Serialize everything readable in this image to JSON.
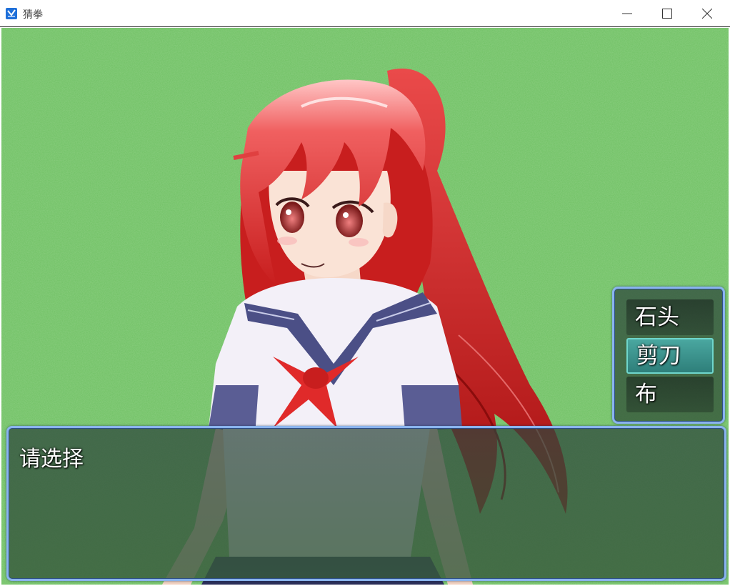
{
  "window": {
    "title": "猜拳",
    "icon": "app-icon"
  },
  "game": {
    "background_color": "#6fc063",
    "character": "red-haired-schoolgirl"
  },
  "choices": {
    "items": [
      {
        "label": "石头"
      },
      {
        "label": "剪刀"
      },
      {
        "label": "布"
      }
    ],
    "selected_index": 1
  },
  "message": {
    "text": "请选择"
  }
}
